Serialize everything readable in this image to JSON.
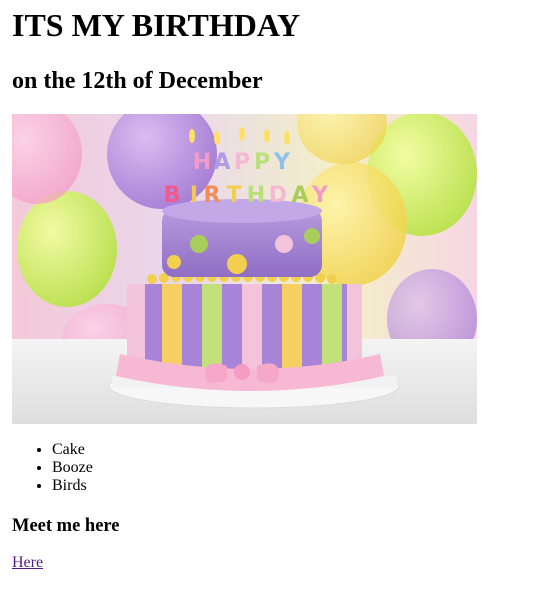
{
  "page": {
    "heading": "ITS MY BIRTHDAY",
    "subheading": "on the 12th of December",
    "image": {
      "alt": "Birthday cake",
      "candle_letters_top": [
        "H",
        "A",
        "P",
        "P",
        "Y"
      ],
      "candle_letters_bottom": [
        "B",
        "I",
        "R",
        "T",
        "H",
        "D",
        "A",
        "Y"
      ]
    },
    "list_items": [
      "Cake",
      "Booze",
      "Birds"
    ],
    "meet_heading": "Meet me here",
    "link_label": "Here"
  },
  "colors": {
    "link": "#551a8b",
    "text": "#000000",
    "background": "#ffffff"
  }
}
